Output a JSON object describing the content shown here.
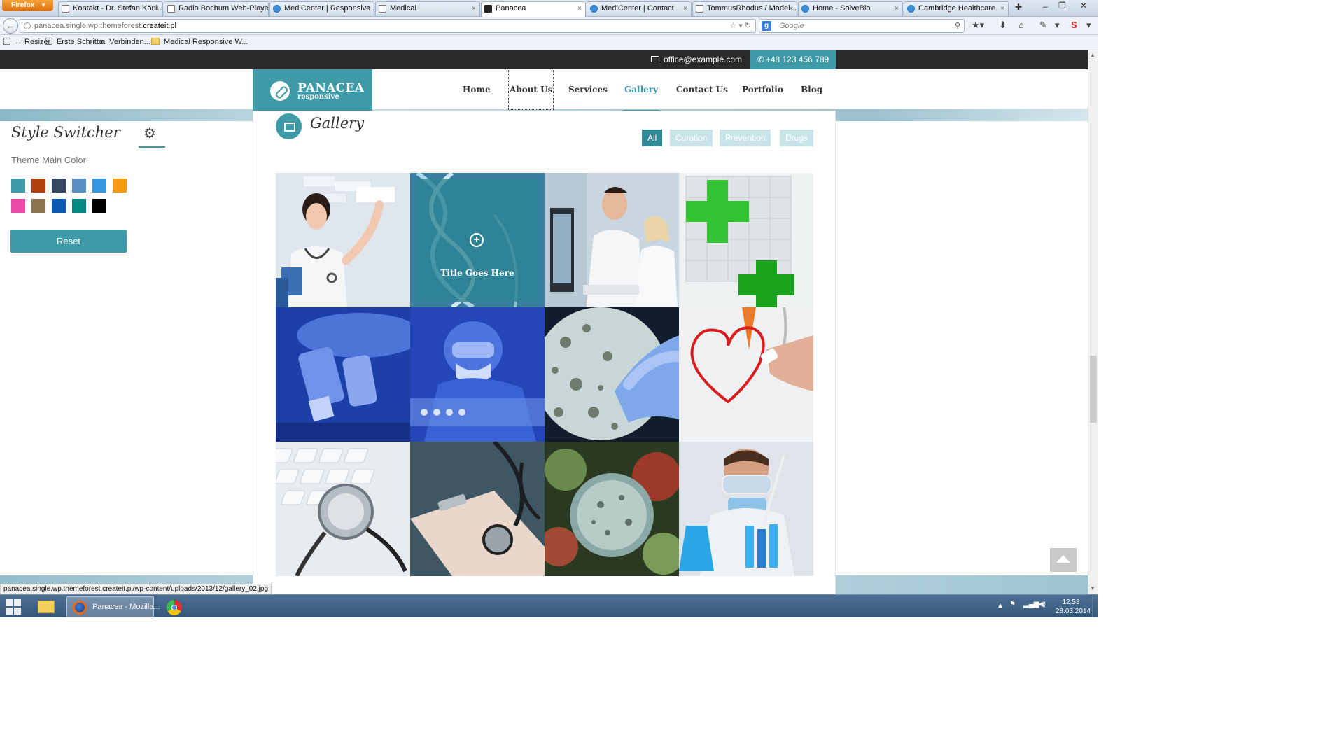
{
  "browser": {
    "menu_button": "Firefox",
    "tabs": [
      {
        "label": "Kontakt - Dr. Stefan Köni...",
        "active": false
      },
      {
        "label": "Radio Bochum Web-Player",
        "active": false
      },
      {
        "label": "MediCenter | Responsive ...",
        "active": false
      },
      {
        "label": "Medical",
        "active": false
      },
      {
        "label": "Panacea",
        "active": true
      },
      {
        "label": "MediCenter | Contact",
        "active": false
      },
      {
        "label": "TommusRhodus / Madel...",
        "active": false
      },
      {
        "label": "Home - SolveBio",
        "active": false
      },
      {
        "label": "Cambridge Healthcare",
        "active": false
      }
    ],
    "close_glyph": "×",
    "url_prefix": "panacea.single.wp.themeforest.",
    "url_host": "createit.pl",
    "search_placeholder": "Google",
    "bookmarks": [
      "↔ Resizer",
      "Erste Schritte",
      "Verbinden...",
      "Medical Responsive W..."
    ],
    "status_url": "panacea.single.wp.themeforest.createit.pl/wp-content/uploads/2013/12/gallery_02.jpg"
  },
  "topbar": {
    "email": "office@example.com",
    "phone": "+48 123 456 789"
  },
  "logo": {
    "name": "PANACEA",
    "tagline": "responsive"
  },
  "nav": {
    "items": [
      {
        "label": "Home"
      },
      {
        "label": "About Us"
      },
      {
        "label": "Services"
      },
      {
        "label": "Gallery"
      },
      {
        "label": "Contact Us"
      },
      {
        "label": "Portfolio"
      },
      {
        "label": "Blog"
      }
    ],
    "active": "Gallery"
  },
  "style_switcher": {
    "title": "Style Switcher",
    "subtitle": "Theme Main Color",
    "colors": [
      "#3d9aa6",
      "#b3410f",
      "#35475e",
      "#5b8fc4",
      "#3597e0",
      "#f49b11",
      "#ec4aa8",
      "#8c7350",
      "#0d5ab5",
      "#008a85",
      "#000000"
    ],
    "reset_label": "Reset"
  },
  "gallery": {
    "title": "Gallery",
    "filters": [
      {
        "label": "All",
        "active": true
      },
      {
        "label": "Curation",
        "active": false
      },
      {
        "label": "Prevention",
        "active": false
      },
      {
        "label": "Drugs",
        "active": false
      }
    ],
    "hover_caption": "Title Goes Here",
    "items": [
      {
        "subject": "nurse-touching-screen"
      },
      {
        "subject": "dna-helix"
      },
      {
        "subject": "scientists-at-computer"
      },
      {
        "subject": "green-cross-cubes"
      },
      {
        "subject": "microscope"
      },
      {
        "subject": "lab-researcher-with-mask"
      },
      {
        "subject": "petri-dish-bacteria"
      },
      {
        "subject": "doctor-drawing-heart"
      },
      {
        "subject": "stethoscope-on-keyboard"
      },
      {
        "subject": "stethoscope-and-clipboard"
      },
      {
        "subject": "virus-particle"
      },
      {
        "subject": "chemist-with-pipette"
      }
    ]
  },
  "taskbar": {
    "active_app": "Panacea - Mozilla...",
    "time": "12:53",
    "date": "28.03.2014"
  }
}
